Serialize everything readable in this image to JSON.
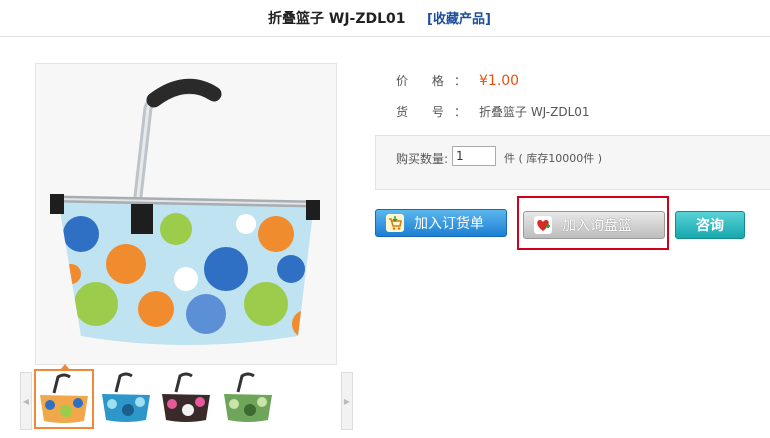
{
  "header": {
    "title": "折叠篮子 WJ-ZDL01",
    "favorite_label": "[收藏产品]"
  },
  "product": {
    "price_label": "价 格",
    "colon": "：",
    "price_value": "¥1.00",
    "sku_label": "货 号",
    "sku_value": "折叠篮子 WJ-ZDL01"
  },
  "purchase": {
    "qty_label": "购买数量:",
    "qty_value": "1",
    "qty_unit": "件 ( 库存10000件 )"
  },
  "buttons": {
    "add_order": "加入订货单",
    "add_inquiry": "加入询盘篮",
    "consult": "咨询"
  },
  "thumbnails": [
    {
      "color": "#f0a84a",
      "selected": true
    },
    {
      "color": "#2d97c9",
      "selected": false
    },
    {
      "color": "#3a2a2a",
      "selected": false
    },
    {
      "color": "#6ea55a",
      "selected": false
    }
  ]
}
